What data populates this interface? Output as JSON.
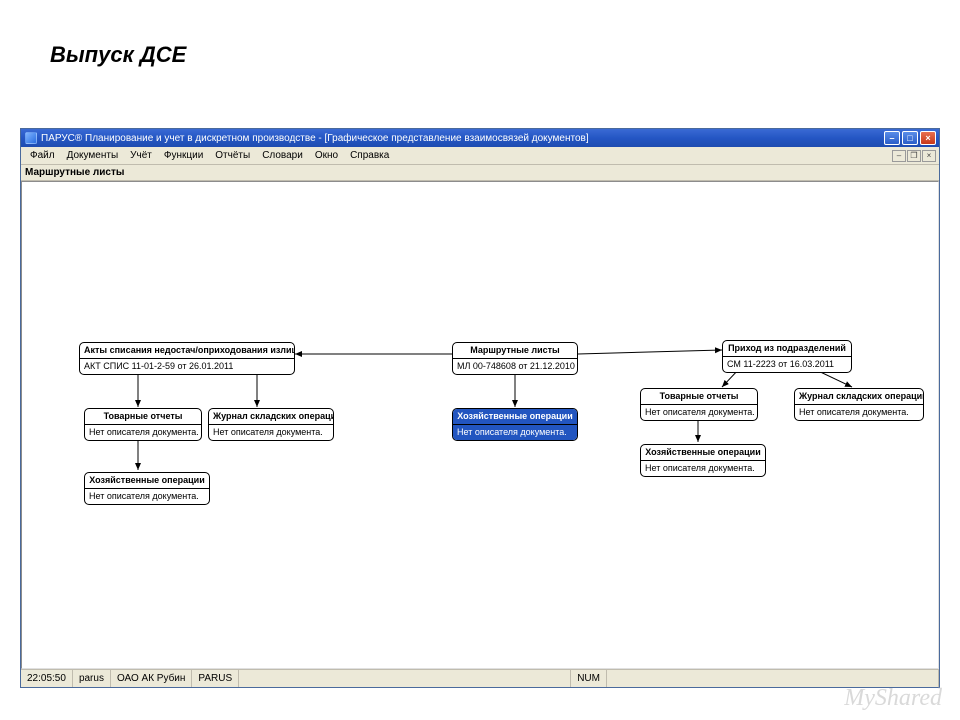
{
  "slide": {
    "title": "Выпуск ДСЕ"
  },
  "window": {
    "title": "ПАРУС® Планирование и учет в дискретном производстве - [Графическое представление взаимосвязей документов]"
  },
  "menu": {
    "items": [
      "Файл",
      "Документы",
      "Учёт",
      "Функции",
      "Отчёты",
      "Словари",
      "Окно",
      "Справка"
    ]
  },
  "toolbar": {
    "label": "Маршрутные листы"
  },
  "nodes": {
    "n1": {
      "title": "Акты списания недостач/оприходования излишков",
      "body": "АКТ СПИС 11-01-2-59 от 26.01.2011"
    },
    "n2": {
      "title": "Маршрутные листы",
      "body": "МЛ 00-748608 от 21.12.2010"
    },
    "n3": {
      "title": "Приход из подразделений",
      "body": "СМ 11-2223 от 16.03.2011"
    },
    "n4": {
      "title": "Товарные отчеты",
      "body": "Нет описателя документа."
    },
    "n5": {
      "title": "Журнал складских операций",
      "body": "Нет описателя документа."
    },
    "n6": {
      "title": "Хозяйственные операции",
      "body": "Нет описателя документа."
    },
    "n7": {
      "title": "Товарные отчеты",
      "body": "Нет описателя документа."
    },
    "n8": {
      "title": "Журнал складских операций",
      "body": "Нет описателя документа."
    },
    "n9": {
      "title": "Хозяйственные операции",
      "body": "Нет описателя документа."
    },
    "n10": {
      "title": "Хозяйственные операции",
      "body": "Нет описателя документа."
    }
  },
  "status": {
    "time": "22:05:50",
    "user": "parus",
    "org": "ОАО АК Рубин",
    "db": "PARUS",
    "mode": "NUM"
  },
  "watermark": "MyShared"
}
